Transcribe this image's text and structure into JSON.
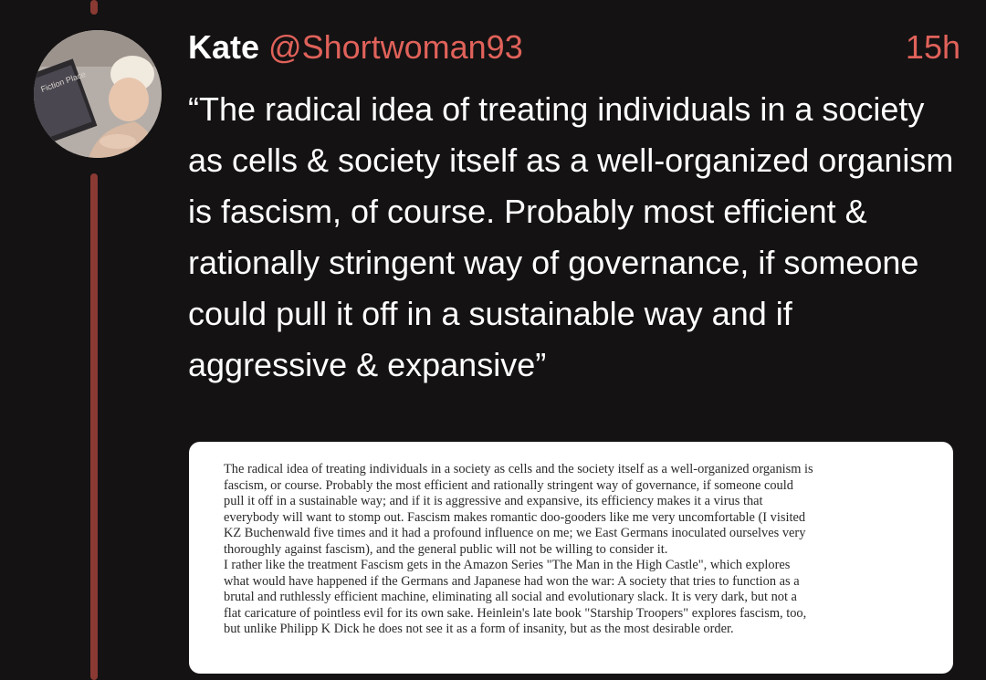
{
  "tweet": {
    "author_name": "Kate",
    "handle": "@Shortwoman93",
    "time": "15h",
    "text": "“The radical idea of treating individuals in a society as cells & society itself as  a well-organized organism is fascism, of course. Probably most efficient & rationally stringent way of governance, if someone could pull it off in a sustainable way and if aggressive & expansive”",
    "avatar_book_text": "Fiction Place"
  },
  "attachment": {
    "lines": [
      "The radical idea of treating individuals in a society as cells and the society itself as a well-organized organism is",
      "fascism, or course. Probably the most efficient and rationally stringent way of governance, if someone could",
      "pull it off in a sustainable way; and if it is aggressive and expansive, its efficiency makes it a virus that",
      "everybody will want to stomp out. Fascism makes romantic doo-gooders like me very uncomfortable (I visited",
      "KZ Buchenwald five times and it had a profound influence on me; we East Germans inoculated ourselves very",
      "thoroughly against fascism), and the general public will not be willing to consider it.",
      "I rather like the treatment Fascism gets in the Amazon Series \"The Man in the High Castle\", which explores",
      "what would have happened if the Germans and Japanese had won the war: A society that tries to function as a",
      "brutal and ruthlessly efficient machine, eliminating all social and evolutionary slack. It is very dark, but not a",
      "flat caricature of pointless evil for its own sake. Heinlein's late book \"Starship Troopers\" explores fascism, too,",
      "but unlike Philipp K Dick he does not see it as a form of insanity, but as the most desirable order."
    ]
  },
  "colors": {
    "background": "#141213",
    "accent": "#e0625a",
    "thread_line": "#8a3a33",
    "text": "#ffffff"
  }
}
